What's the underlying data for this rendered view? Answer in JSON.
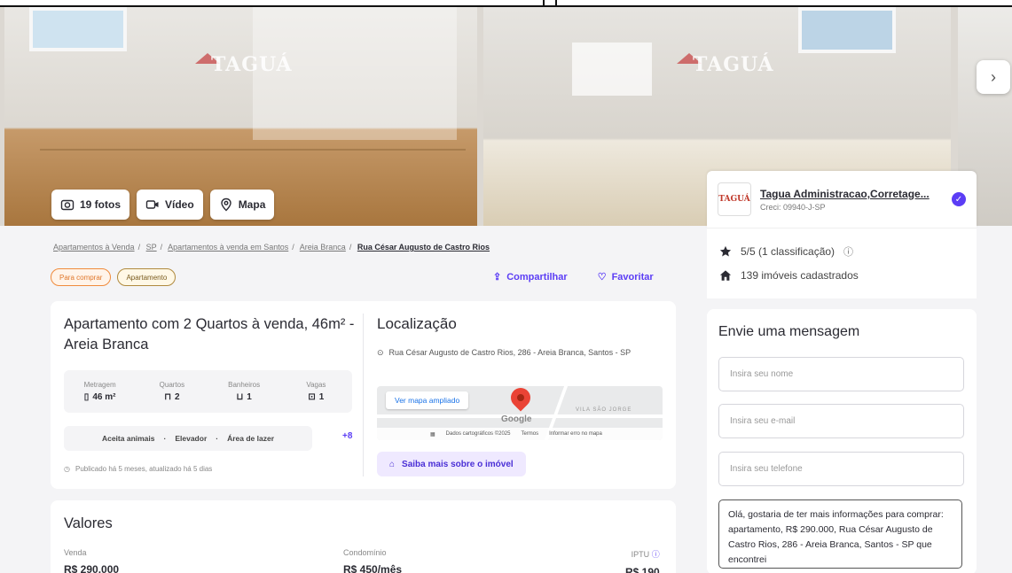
{
  "gallery": {
    "photos_button": "19 fotos",
    "video_button": "Vídeo",
    "map_button": "Mapa",
    "watermark": "TAGUÁ",
    "next_icon": "chevron-right-icon"
  },
  "agent": {
    "logo_text": "TAGUÁ",
    "name": "Tagua Administracao,Corretage...",
    "creci": "Creci: 09940-J-SP",
    "rating": "5/5 (1 classificação)",
    "listings": "139 imóveis cadastrados"
  },
  "breadcrumb": {
    "items": [
      "Apartamentos à Venda",
      "SP",
      "Apartamentos à venda em Santos",
      "Areia Branca"
    ],
    "current": "Rua César Augusto de Castro Rios",
    "separator": "/"
  },
  "tags": [
    "Para comprar",
    "Apartamento"
  ],
  "actions": {
    "share": "Compartilhar",
    "favorite": "Favoritar"
  },
  "property": {
    "title": "Apartamento com 2 Quartos à venda, 46m² - Areia Branca",
    "features": [
      {
        "label": "Metragem",
        "value": "46 m²",
        "icon": "ruler-icon"
      },
      {
        "label": "Quartos",
        "value": "2",
        "icon": "bed-icon"
      },
      {
        "label": "Banheiros",
        "value": "1",
        "icon": "bath-icon"
      },
      {
        "label": "Vagas",
        "value": "1",
        "icon": "car-icon"
      }
    ],
    "amenities": [
      "Aceita animais",
      "Elevador",
      "Área de lazer"
    ],
    "amenities_more": "+8",
    "published": "Publicado há 5 meses, atualizado há 5 dias"
  },
  "location": {
    "title": "Localização",
    "address": "Rua César Augusto de Castro Rios, 286 - Areia Branca, Santos - SP",
    "map_link": "Ver mapa ampliado",
    "map_brand": "Google",
    "map_area": "VILA SÃO JORGE",
    "map_footer": [
      "Dados cartográficos ©2025",
      "Termos",
      "Informar erro no mapa"
    ],
    "learn_more": "Saiba mais sobre o imóvel"
  },
  "values": {
    "title": "Valores",
    "items": [
      {
        "label": "Venda",
        "value": "R$ 290.000"
      },
      {
        "label": "Condomínio",
        "value": "R$ 450/mês"
      },
      {
        "label": "IPTU",
        "value": "R$ 190"
      }
    ]
  },
  "message": {
    "title": "Envie uma mensagem",
    "name_placeholder": "Insira seu nome",
    "email_placeholder": "Insira seu e-mail",
    "phone_placeholder": "Insira seu telefone",
    "text": "Olá, gostaria de ter mais informações para comprar: apartamento, R$ 290.000, Rua César Augusto de Castro Rios, 286 - Areia Branca, Santos - SP que encontrei"
  },
  "colors": {
    "accent": "#5b3df5",
    "tag_orange": "#f08b3c"
  }
}
